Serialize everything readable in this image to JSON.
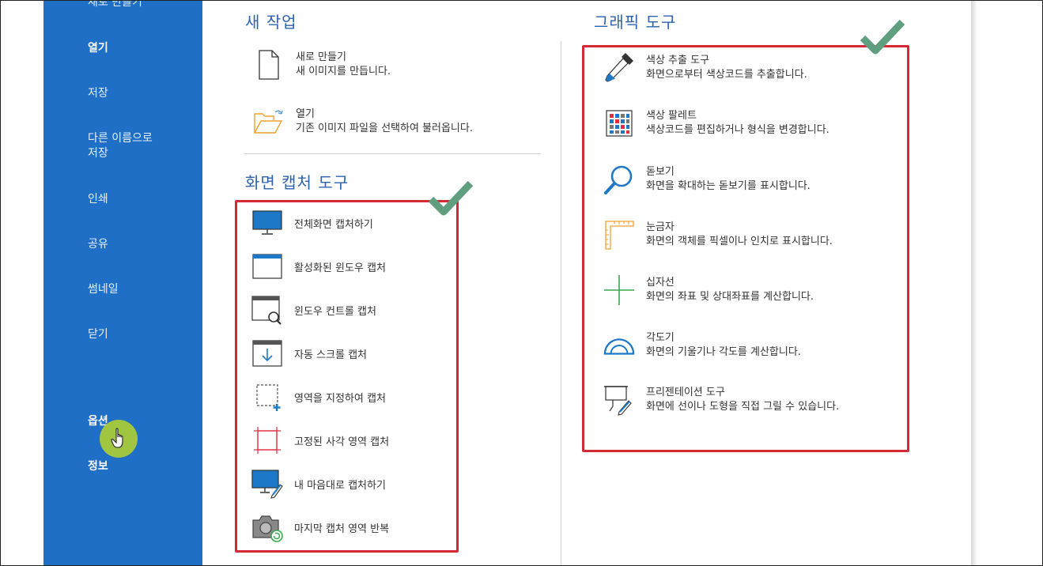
{
  "sidebar": {
    "items": [
      {
        "label": "새로 만들기"
      },
      {
        "label": "열기"
      },
      {
        "label": "저장"
      },
      {
        "label": "다른 이름으로\n저장"
      },
      {
        "label": "인쇄"
      },
      {
        "label": "공유"
      },
      {
        "label": "썸네일"
      },
      {
        "label": "닫기"
      },
      {
        "label": "옵션"
      },
      {
        "label": "정보"
      }
    ]
  },
  "new_task": {
    "title": "새 작업",
    "items": [
      {
        "title": "새로 만들기",
        "desc": "새 이미지를 만듭니다.",
        "icon": "new-file-icon"
      },
      {
        "title": "열기",
        "desc": "기존 이미지 파일을 선택하여 불러옵니다.",
        "icon": "open-folder-icon"
      }
    ]
  },
  "capture_tools": {
    "title": "화면 캡처 도구",
    "items": [
      {
        "label": "전체화면 캡처하기",
        "icon": "monitor-icon"
      },
      {
        "label": "활성화된 윈도우 캡처",
        "icon": "window-icon"
      },
      {
        "label": "윈도우 컨트롤 캡처",
        "icon": "window-search-icon"
      },
      {
        "label": "자동 스크롤 캡처",
        "icon": "scroll-down-icon"
      },
      {
        "label": "영역을 지정하여 캡처",
        "icon": "region-select-icon"
      },
      {
        "label": "고정된 사각 영역 캡처",
        "icon": "fixed-rect-icon"
      },
      {
        "label": "내 마음대로 캡처하기",
        "icon": "monitor-pen-icon"
      },
      {
        "label": "마지막 캡처 영역 반복",
        "icon": "camera-repeat-icon"
      }
    ]
  },
  "graphic_tools": {
    "title": "그래픽 도구",
    "items": [
      {
        "title": "색상 추출 도구",
        "desc": "화면으로부터 색상코드를 추출합니다.",
        "icon": "eyedropper-icon"
      },
      {
        "title": "색상 팔레트",
        "desc": "색상코드를 편집하거나 형식을 변경합니다.",
        "icon": "palette-grid-icon"
      },
      {
        "title": "돋보기",
        "desc": "화면을 확대하는 돋보기를 표시합니다.",
        "icon": "magnifier-icon"
      },
      {
        "title": "눈금자",
        "desc": "화면의 객체를 픽셀이나 인치로 표시합니다.",
        "icon": "ruler-icon"
      },
      {
        "title": "십자선",
        "desc": "화면의 좌표 및 상대좌표를 계산합니다.",
        "icon": "crosshair-icon"
      },
      {
        "title": "각도기",
        "desc": "화면의 기울기나 각도를 계산합니다.",
        "icon": "protractor-icon"
      },
      {
        "title": "프리젠테이션 도구",
        "desc": "화면에 선이나 도형을 직접 그릴 수 있습니다.",
        "icon": "presentation-pen-icon"
      }
    ]
  },
  "colors": {
    "sidebar": "#1f6fc6",
    "section_title": "#2b63b0",
    "highlight_box": "#d42a35",
    "check_mark": "#5f9e7e",
    "cursor_highlight": "#a8c93a"
  }
}
